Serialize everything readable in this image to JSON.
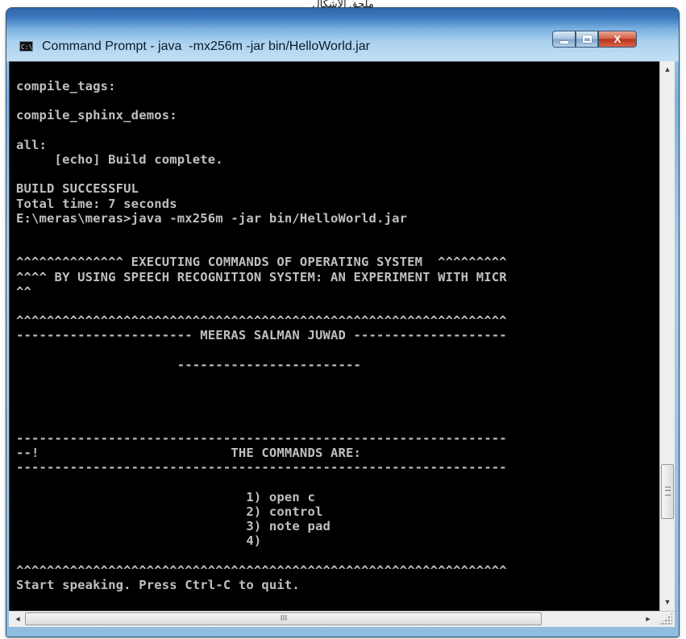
{
  "caption": "ملحق الاشكال",
  "window": {
    "title": "Command Prompt - java  -mx256m -jar bin/HelloWorld.jar",
    "icon": "cmd-icon",
    "controls": [
      "minimize-icon",
      "maximize-icon",
      "close-icon"
    ]
  },
  "console": {
    "lines": [
      "compile_tags:",
      "",
      "compile_sphinx_demos:",
      "",
      "all:",
      "     [echo] Build complete.",
      "",
      "BUILD SUCCESSFUL",
      "Total time: 7 seconds",
      "E:\\meras\\meras>java -mx256m -jar bin/HelloWorld.jar",
      "",
      "",
      "^^^^^^^^^^^^^^ EXECUTING COMMANDS OF OPERATING SYSTEM  ^^^^^^^^^",
      "^^^^ BY USING SPEECH RECOGNITION SYSTEM: AN EXPERIMENT WITH MICR",
      "^^",
      "",
      "^^^^^^^^^^^^^^^^^^^^^^^^^^^^^^^^^^^^^^^^^^^^^^^^^^^^^^^^^^^^^^^^",
      "----------------------- MEERAS SALMAN JUWAD --------------------",
      "",
      "                     ------------------------",
      "",
      "",
      "",
      "",
      "----------------------------------------------------------------",
      "--!                         THE COMMANDS ARE:",
      "----------------------------------------------------------------",
      "",
      "                              1) open c",
      "                              2) control",
      "                              3) note pad",
      "                              4)",
      "",
      "^^^^^^^^^^^^^^^^^^^^^^^^^^^^^^^^^^^^^^^^^^^^^^^^^^^^^^^^^^^^^^^^",
      "Start speaking. Press Ctrl-C to quit."
    ]
  },
  "scrollbars": {
    "vertical": {
      "up_arrow": "▲",
      "down_arrow": "▼",
      "grip": "≡"
    },
    "horizontal": {
      "left_arrow": "◄",
      "right_arrow": "►",
      "grip": "III"
    }
  }
}
